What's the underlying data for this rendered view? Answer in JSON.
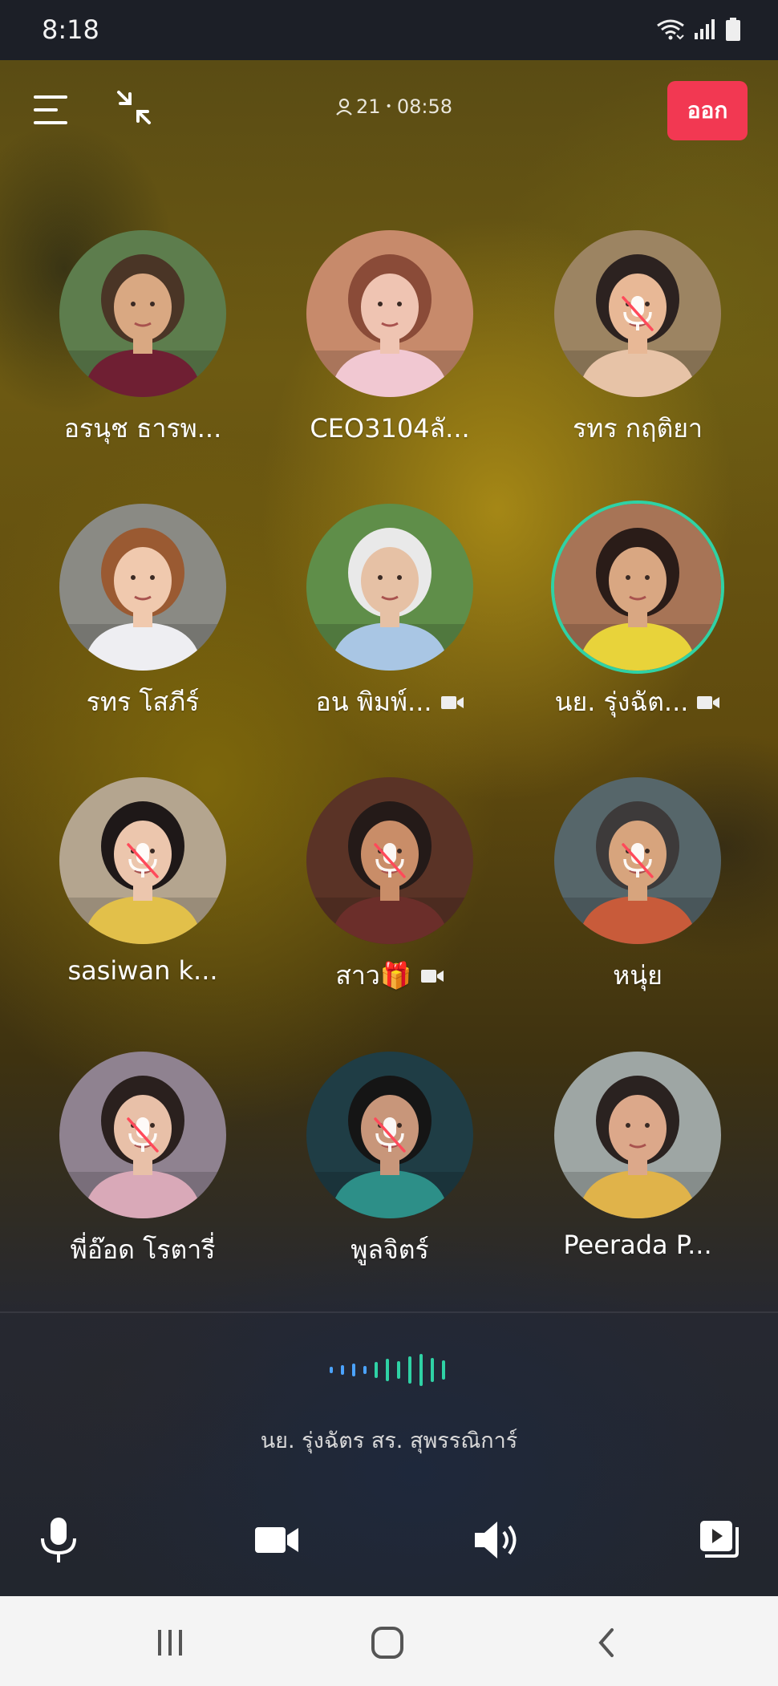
{
  "status_bar": {
    "time": "8:18"
  },
  "top_bar": {
    "participants": "21",
    "separator": "•",
    "duration": "08:58",
    "leave_label": "ออก"
  },
  "participants": [
    {
      "name": "อรนุช ธารพ...",
      "muted": false,
      "camera": false,
      "speaking": false,
      "skin": "#d9a882",
      "hair": "#4a3526",
      "shirt": "#6f1f33",
      "bg": "#5d7d4d"
    },
    {
      "name": "CEO3104ลั...",
      "muted": false,
      "camera": false,
      "speaking": false,
      "skin": "#efc4b2",
      "hair": "#8a4b38",
      "shirt": "#f1c8d2",
      "bg": "#c78a6b"
    },
    {
      "name": "รทร กฤติยา",
      "muted": true,
      "camera": false,
      "speaking": false,
      "skin": "#e8b896",
      "hair": "#2c2220",
      "shirt": "#e7c3a7",
      "bg": "#9c8462"
    },
    {
      "name": "รทร โสภีร์",
      "muted": false,
      "camera": false,
      "speaking": false,
      "skin": "#f0c9ae",
      "hair": "#9a5a32",
      "shirt": "#eeeef2",
      "bg": "#8a8a84"
    },
    {
      "name": "อน พิมพ์...",
      "muted": false,
      "camera": true,
      "speaking": false,
      "skin": "#e6c1a5",
      "hair": "#e9e9e9",
      "shirt": "#a9c6e4",
      "bg": "#5f8e49"
    },
    {
      "name": "นย. รุ่งฉัต...",
      "muted": false,
      "camera": true,
      "speaking": true,
      "skin": "#d9a782",
      "hair": "#2a1c18",
      "shirt": "#e8d33a",
      "bg": "#a77456"
    },
    {
      "name": "sasiwan  k...",
      "muted": true,
      "camera": false,
      "speaking": false,
      "skin": "#ecc6ad",
      "hair": "#1e1818",
      "shirt": "#e2c04a",
      "bg": "#b4a58f"
    },
    {
      "name": "สาว🎁",
      "muted": true,
      "camera": true,
      "speaking": false,
      "skin": "#c98d68",
      "hair": "#241a18",
      "shirt": "#6b2e2a",
      "bg": "#5a3326"
    },
    {
      "name": "หนุ่ย",
      "muted": true,
      "camera": false,
      "speaking": false,
      "skin": "#d7a47d",
      "hair": "#3d3a3a",
      "shirt": "#c85b3a",
      "bg": "#56666a"
    },
    {
      "name": "พี่อ๊อด โรตารี่",
      "muted": true,
      "camera": false,
      "speaking": false,
      "skin": "#e8c0a8",
      "hair": "#2a201e",
      "shirt": "#d9a9b8",
      "bg": "#8f8290"
    },
    {
      "name": "พูลจิตร์",
      "muted": true,
      "camera": false,
      "speaking": false,
      "skin": "#c8967a",
      "hair": "#151515",
      "shirt": "#2d8f88",
      "bg": "#1f3d45"
    },
    {
      "name": "Peerada P...",
      "muted": false,
      "camera": false,
      "speaking": false,
      "skin": "#dca88a",
      "hair": "#2a2220",
      "shirt": "#e0b34a",
      "bg": "#9ea6a4"
    }
  ],
  "current_speaker": "นย. รุ่งฉัตร สร. สุพรรณิการ์",
  "icons": {
    "menu": "menu-icon",
    "minimize": "minimize-icon",
    "participants": "person-icon",
    "mic": "microphone-icon",
    "camera": "camera-icon",
    "speaker": "speaker-icon",
    "screen": "screen-share-icon"
  },
  "colors": {
    "leave": "#f23852",
    "speaking_ring": "#2fd2a5",
    "mute_slash": "#ff4a5a",
    "wave_blue": "#4ba3ff",
    "wave_green": "#2fd2a5"
  }
}
